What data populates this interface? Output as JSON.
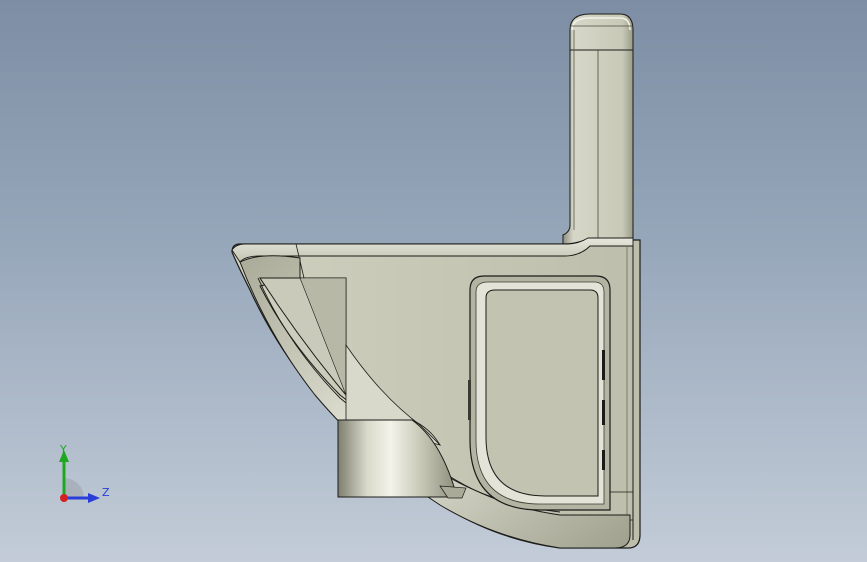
{
  "viewport": {
    "background_top": "#7d8ea4",
    "background_bottom": "#c3ccd8"
  },
  "model": {
    "body_color": "#c7c8b6",
    "edge_color": "#1b1c18",
    "highlight_color": "#eeeee3",
    "shadow_color": "#8b8c7a"
  },
  "triad": {
    "y_label": "Y",
    "z_label": "Z",
    "y_color": "#1fa81f",
    "z_color": "#2a3dd6",
    "x_color": "#d42020"
  }
}
